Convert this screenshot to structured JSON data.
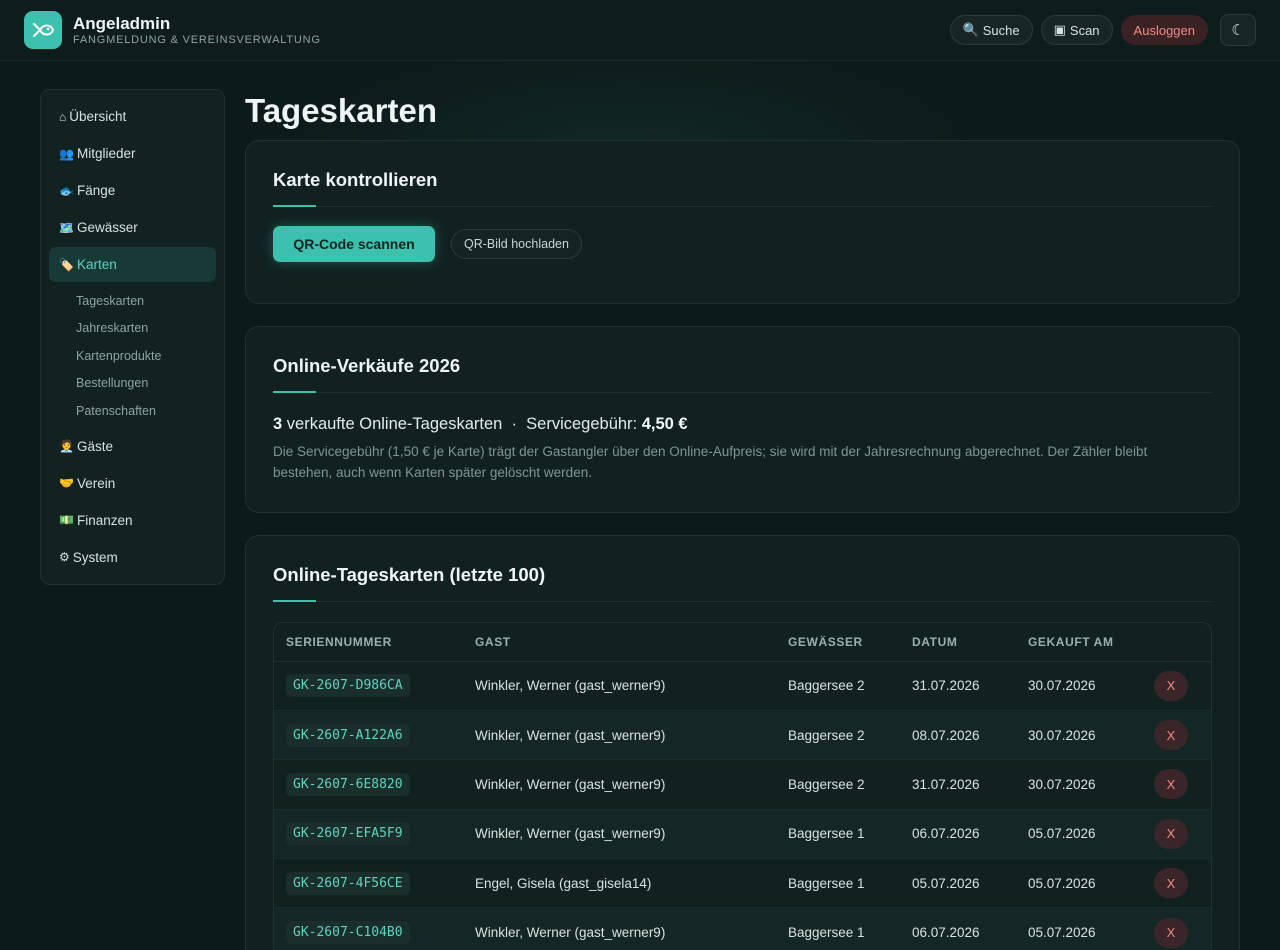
{
  "header": {
    "brand_name": "Angeladmin",
    "brand_sub": "Fangmeldung & Vereinsverwaltung",
    "search_label": "Suche",
    "scan_label": "Scan",
    "logout_label": "Ausloggen",
    "theme_icon": "☾"
  },
  "sidebar": {
    "items": [
      {
        "icon": "⌂",
        "label": "Übersicht"
      },
      {
        "icon": "👥",
        "label": "Mitglieder"
      },
      {
        "icon": "🐟",
        "label": "Fänge"
      },
      {
        "icon": "🗺️",
        "label": "Gewässer"
      },
      {
        "icon": "🏷️",
        "label": "Karten"
      },
      {
        "icon": "🧑‍💼",
        "label": "Gäste"
      },
      {
        "icon": "🤝",
        "label": "Verein"
      },
      {
        "icon": "💵",
        "label": "Finanzen"
      },
      {
        "icon": "⚙",
        "label": "System"
      }
    ],
    "sub_items": [
      "Tageskarten",
      "Jahreskarten",
      "Kartenprodukte",
      "Bestellungen",
      "Patenschaften"
    ]
  },
  "page": {
    "title": "Tageskarten"
  },
  "control_card": {
    "title": "Karte kontrollieren",
    "scan_button": "QR-Code scannen",
    "upload_button": "QR-Bild hochladen"
  },
  "sales_card": {
    "title": "Online-Verkäufe 2026",
    "count": "3",
    "count_text": "verkaufte Online-Tageskarten",
    "separator": "·",
    "fee_label": "Servicegebühr:",
    "fee_value": "4,50 €",
    "note": "Die Servicegebühr (1,50 € je Karte) trägt der Gastangler über den Online-Aufpreis; sie wird mit der Jahresrechnung abgerechnet. Der Zähler bleibt bestehen, auch wenn Karten später gelöscht werden."
  },
  "table_card": {
    "title": "Online-Tageskarten (letzte 100)",
    "columns": [
      "Seriennummer",
      "Gast",
      "Gewässer",
      "Datum",
      "Gekauft am"
    ],
    "delete_label": "X",
    "rows": [
      {
        "serial": "GK-2607-D986CA",
        "guest": "Winkler, Werner (gast_werner9)",
        "water": "Baggersee 2",
        "date": "31.07.2026",
        "bought": "30.07.2026"
      },
      {
        "serial": "GK-2607-A122A6",
        "guest": "Winkler, Werner (gast_werner9)",
        "water": "Baggersee 2",
        "date": "08.07.2026",
        "bought": "30.07.2026"
      },
      {
        "serial": "GK-2607-6E8820",
        "guest": "Winkler, Werner (gast_werner9)",
        "water": "Baggersee 2",
        "date": "31.07.2026",
        "bought": "30.07.2026"
      },
      {
        "serial": "GK-2607-EFA5F9",
        "guest": "Winkler, Werner (gast_werner9)",
        "water": "Baggersee 1",
        "date": "06.07.2026",
        "bought": "05.07.2026"
      },
      {
        "serial": "GK-2607-4F56CE",
        "guest": "Engel, Gisela (gast_gisela14)",
        "water": "Baggersee 1",
        "date": "05.07.2026",
        "bought": "05.07.2026"
      },
      {
        "serial": "GK-2607-C104B0",
        "guest": "Winkler, Werner (gast_werner9)",
        "water": "Baggersee 1",
        "date": "06.07.2026",
        "bought": "05.07.2026"
      }
    ]
  },
  "colors": {
    "accent": "#3cc1ae",
    "danger": "#f08a86",
    "background": "#0d1a1a"
  }
}
